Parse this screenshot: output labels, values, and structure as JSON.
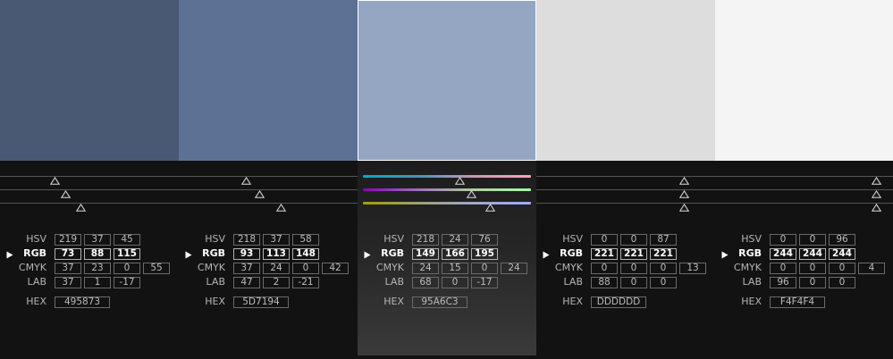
{
  "swatches": [
    {
      "color": "#495873",
      "selected": false,
      "hsv": [
        "219",
        "37",
        "45"
      ],
      "rgb": [
        "73",
        "88",
        "115"
      ],
      "cmyk": [
        "37",
        "23",
        "0",
        "55"
      ],
      "lab": [
        "37",
        "1",
        "-17"
      ],
      "hex": "495873",
      "handles": [
        0.3,
        0.36,
        0.45
      ]
    },
    {
      "color": "#5D7194",
      "selected": false,
      "hsv": [
        "218",
        "37",
        "58"
      ],
      "rgb": [
        "93",
        "113",
        "148"
      ],
      "cmyk": [
        "37",
        "24",
        "0",
        "42"
      ],
      "lab": [
        "47",
        "2",
        "-21"
      ],
      "hex": "5D7194",
      "handles": [
        0.37,
        0.45,
        0.58
      ]
    },
    {
      "color": "#95A6C3",
      "selected": true,
      "hsv": [
        "218",
        "24",
        "76"
      ],
      "rgb": [
        "149",
        "166",
        "195"
      ],
      "cmyk": [
        "24",
        "15",
        "0",
        "24"
      ],
      "lab": [
        "68",
        "0",
        "-17"
      ],
      "hex": "95A6C3",
      "handles": [
        0.58,
        0.65,
        0.76
      ]
    },
    {
      "color": "#DDDDDD",
      "selected": false,
      "hsv": [
        "0",
        "0",
        "87"
      ],
      "rgb": [
        "221",
        "221",
        "221"
      ],
      "cmyk": [
        "0",
        "0",
        "0",
        "13"
      ],
      "lab": [
        "88",
        "0",
        "0"
      ],
      "hex": "DDDDDD",
      "handles": [
        0.85,
        0.85,
        0.85
      ]
    },
    {
      "color": "#F4F4F4",
      "selected": false,
      "hsv": [
        "0",
        "0",
        "96"
      ],
      "rgb": [
        "244",
        "244",
        "244"
      ],
      "cmyk": [
        "0",
        "0",
        "0",
        "4"
      ],
      "lab": [
        "96",
        "0",
        "0"
      ],
      "hex": "F4F4F4",
      "handles": [
        0.93,
        0.93,
        0.93
      ]
    }
  ],
  "labels": {
    "hsv": "HSV",
    "rgb": "RGB",
    "cmyk": "CMYK",
    "lab": "LAB",
    "hex": "HEX"
  },
  "icons": {
    "handle": "triangle-up-icon",
    "active": "play-triangle-icon"
  }
}
